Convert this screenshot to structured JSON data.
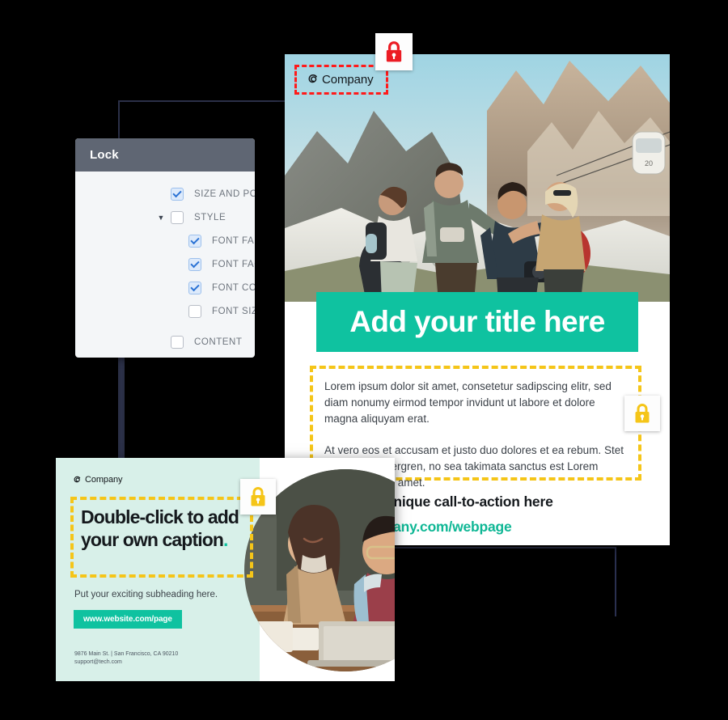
{
  "lock_panel": {
    "title": "Lock",
    "options": [
      {
        "label": "SIZE AND POSITION",
        "checked": true,
        "indent": 0,
        "caret": ""
      },
      {
        "label": "STYLE",
        "checked": false,
        "indent": 0,
        "caret": "▼"
      },
      {
        "label": "FONT FAMILY",
        "checked": true,
        "indent": 1,
        "caret": ""
      },
      {
        "label": "FONT FACE",
        "checked": true,
        "indent": 1,
        "caret": ""
      },
      {
        "label": "FONT COLOR",
        "checked": true,
        "indent": 1,
        "caret": ""
      },
      {
        "label": "FONT SIZE",
        "checked": false,
        "indent": 1,
        "caret": ""
      },
      {
        "label": "CONTENT",
        "checked": false,
        "indent": 0,
        "caret": ""
      }
    ]
  },
  "poster": {
    "logo": "Company",
    "title": "Add your title here",
    "body_paragraph_1": "Lorem ipsum dolor sit amet, consetetur sadipscing elitr, sed diam nonumy eirmod tempor invidunt ut labore et dolore magna aliquyam erat.",
    "body_paragraph_2": "At vero eos et accusam et justo duo dolores et ea rebum. Stet clita kasd gubergren, no sea takimata sanctus est Lorem ipsum dolor sit amet.",
    "cta": "Add your unique call-to-action here",
    "url": "www.company.com/webpage"
  },
  "card": {
    "logo": "Company",
    "caption": "Double-click to add your own caption",
    "caption_period": ".",
    "subheading": "Put your exciting subheading here.",
    "button_label": "www.website.com/page",
    "address_line_1": "9876 Main St. | San Francisco, CA 90210",
    "address_line_2": "support@tech.com"
  },
  "badges": [
    {
      "name": "lock-badge-red",
      "icon": "lock-icon",
      "color": "#ec1c24"
    },
    {
      "name": "lock-badge-yellow-poster",
      "icon": "lock-icon",
      "color": "#f5c518"
    },
    {
      "name": "lock-badge-yellow-card",
      "icon": "lock-icon",
      "color": "#f5c518"
    }
  ],
  "colors": {
    "teal": "#0fc2a0",
    "yellow": "#f5c518",
    "red": "#ec1c24",
    "mint": "#d8f0e9",
    "panel_header": "#5f6673",
    "checkbox_blue": "#2a72d4"
  }
}
